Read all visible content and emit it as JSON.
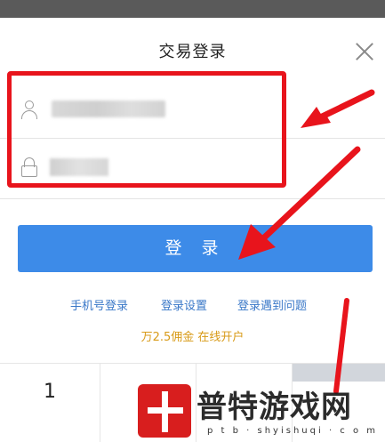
{
  "dialog": {
    "title": "交易登录",
    "close_icon": "close-icon"
  },
  "form": {
    "account_icon": "user-icon",
    "account_value": "",
    "password_icon": "lock-icon",
    "password_placeholder": "交易密码"
  },
  "login_button": {
    "label": "登 录"
  },
  "links": {
    "phone_login": "手机号登录",
    "login_settings": "登录设置",
    "login_problem": "登录遇到问题"
  },
  "promo": {
    "text": "万2.5佣金 在线开户"
  },
  "keypad": {
    "key_1": "1"
  },
  "watermark": {
    "title": "普特游戏网",
    "url": "p t b · shyishuqi · c o m"
  },
  "colors": {
    "accent": "#3d8be8",
    "annotation_red": "#e8141c",
    "link": "#3a78c8",
    "promo": "#d89a17"
  }
}
